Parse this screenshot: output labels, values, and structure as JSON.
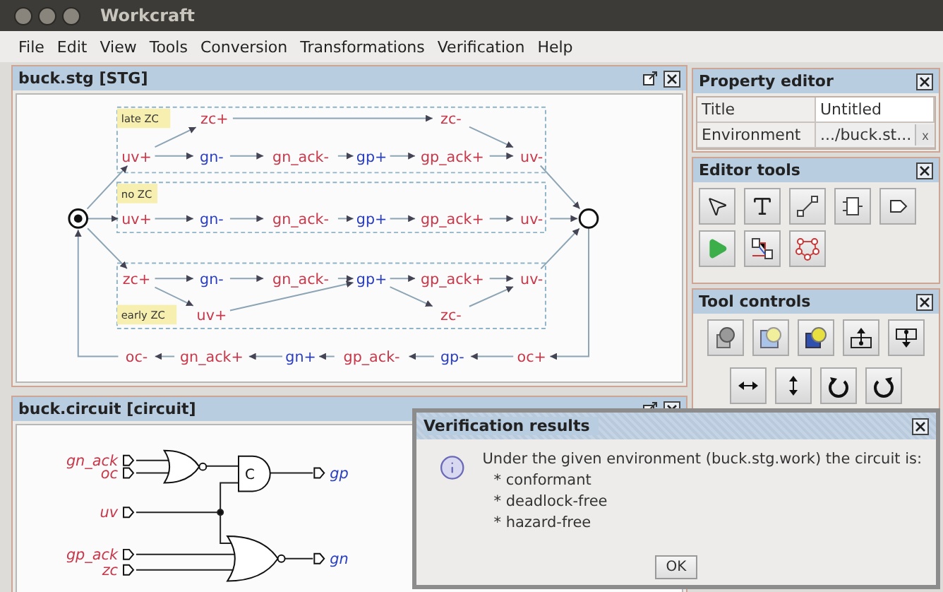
{
  "window": {
    "title": "Workcraft"
  },
  "menu": [
    "File",
    "Edit",
    "View",
    "Tools",
    "Conversion",
    "Transformations",
    "Verification",
    "Help"
  ],
  "stg": {
    "title": "buck.stg [STG]",
    "groups": [
      {
        "label": "late ZC"
      },
      {
        "label": "no ZC"
      },
      {
        "label": "early ZC"
      }
    ],
    "rows": [
      [
        {
          "label": "zc+",
          "kind": "input"
        },
        {
          "label": "zc-",
          "kind": "input"
        }
      ],
      [
        {
          "label": "uv+",
          "kind": "input"
        },
        {
          "label": "gn-",
          "kind": "output"
        },
        {
          "label": "gn_ack-",
          "kind": "input"
        },
        {
          "label": "gp+",
          "kind": "output"
        },
        {
          "label": "gp_ack+",
          "kind": "input"
        },
        {
          "label": "uv-",
          "kind": "input"
        }
      ],
      [
        {
          "label": "uv+",
          "kind": "input"
        },
        {
          "label": "gn-",
          "kind": "output"
        },
        {
          "label": "gn_ack-",
          "kind": "input"
        },
        {
          "label": "gp+",
          "kind": "output"
        },
        {
          "label": "gp_ack+",
          "kind": "input"
        },
        {
          "label": "uv-",
          "kind": "input"
        }
      ],
      [
        {
          "label": "zc+",
          "kind": "input"
        },
        {
          "label": "gn-",
          "kind": "output"
        },
        {
          "label": "gn_ack-",
          "kind": "input"
        },
        {
          "label": "gp+",
          "kind": "output"
        },
        {
          "label": "gp_ack+",
          "kind": "input"
        },
        {
          "label": "uv-",
          "kind": "input"
        }
      ],
      [
        {
          "label": "uv+",
          "kind": "input"
        },
        {
          "label": "zc-",
          "kind": "input"
        }
      ],
      [
        {
          "label": "oc-",
          "kind": "input"
        },
        {
          "label": "gn_ack+",
          "kind": "input"
        },
        {
          "label": "gn+",
          "kind": "output"
        },
        {
          "label": "gp_ack-",
          "kind": "input"
        },
        {
          "label": "gp-",
          "kind": "output"
        },
        {
          "label": "oc+",
          "kind": "input"
        }
      ]
    ]
  },
  "circuit": {
    "title": "buck.circuit [circuit]",
    "inputs": [
      "gn_ack",
      "oc",
      "uv",
      "gp_ack",
      "zc"
    ],
    "outputs": [
      "gp",
      "gn"
    ],
    "c_element": "C"
  },
  "property_editor": {
    "title": "Property editor",
    "rows": [
      {
        "name": "Title",
        "value": "Untitled"
      },
      {
        "name": "Environment",
        "value": ".../buck.st...",
        "clear": "x"
      }
    ]
  },
  "editor_tools": {
    "title": "Editor tools"
  },
  "tool_controls": {
    "title": "Tool controls"
  },
  "dialog": {
    "title": "Verification results",
    "message": "Under the given environment (buck.stg.work) the circuit is:",
    "items": [
      "* conformant",
      "* deadlock-free",
      "* hazard-free"
    ],
    "button": "OK"
  }
}
